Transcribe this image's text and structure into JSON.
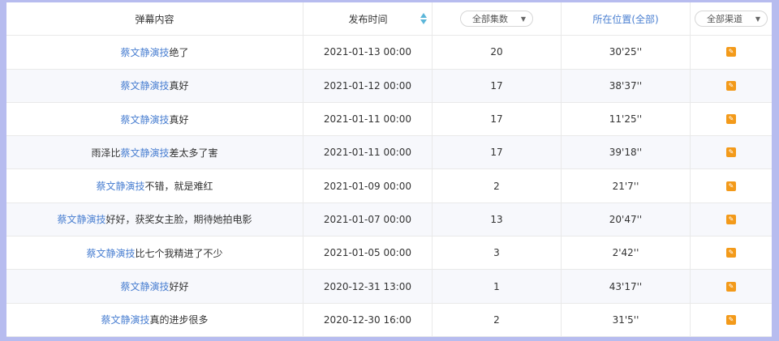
{
  "headers": {
    "content": "弹幕内容",
    "time": "发布时间",
    "episodes": "全部集数",
    "location": "所在位置(全部)",
    "channel": "全部渠道"
  },
  "colors": {
    "keyword": "#4a7fd1",
    "channel_icon": "#f39a1a",
    "frame_bg": "#b7bcef",
    "sort_arrow": "#5bb6d9"
  },
  "icons": {
    "sort": "sort-arrows-icon",
    "dropdown": "caret-down-icon",
    "channel": "orange-channel-icon"
  },
  "rows": [
    {
      "pre": "",
      "kw": "蔡文静演技",
      "post": "绝了",
      "time": "2021-01-13 00:00",
      "ep": "20",
      "loc": "30'25''"
    },
    {
      "pre": "",
      "kw": "蔡文静演技",
      "post": "真好",
      "time": "2021-01-12 00:00",
      "ep": "17",
      "loc": "38'37''"
    },
    {
      "pre": "",
      "kw": "蔡文静演技",
      "post": "真好",
      "time": "2021-01-11 00:00",
      "ep": "17",
      "loc": "11'25''"
    },
    {
      "pre": "雨泽比",
      "kw": "蔡文静演技",
      "post": "差太多了害",
      "time": "2021-01-11 00:00",
      "ep": "17",
      "loc": "39'18''"
    },
    {
      "pre": "",
      "kw": "蔡文静演技",
      "post": "不错，就是难红",
      "time": "2021-01-09 00:00",
      "ep": "2",
      "loc": "21'7''"
    },
    {
      "pre": "",
      "kw": "蔡文静演技",
      "post": "好好，获奖女主脸，期待她拍电影",
      "time": "2021-01-07 00:00",
      "ep": "13",
      "loc": "20'47''"
    },
    {
      "pre": "",
      "kw": "蔡文静演技",
      "post": "比七个我精进了不少",
      "time": "2021-01-05 00:00",
      "ep": "3",
      "loc": "2'42''"
    },
    {
      "pre": "",
      "kw": "蔡文静演技",
      "post": "好好",
      "time": "2020-12-31 13:00",
      "ep": "1",
      "loc": "43'17''"
    },
    {
      "pre": "",
      "kw": "蔡文静演技",
      "post": "真的进步很多",
      "time": "2020-12-30 16:00",
      "ep": "2",
      "loc": "31'5''"
    }
  ]
}
